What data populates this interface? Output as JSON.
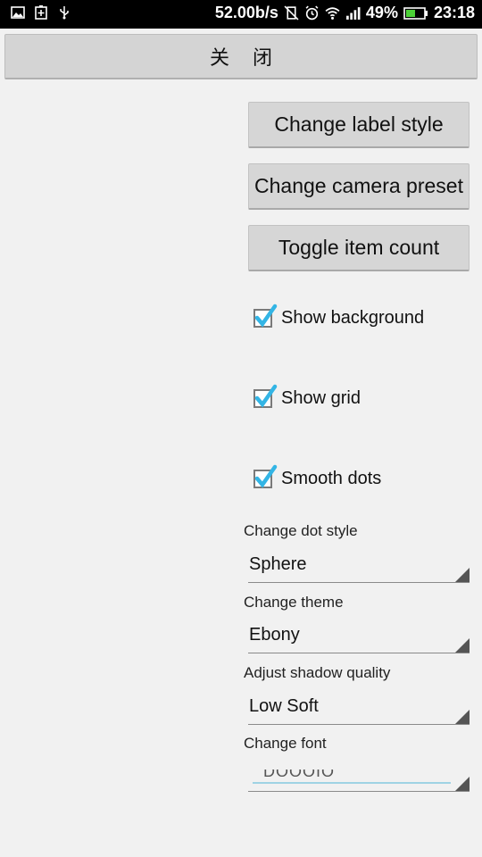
{
  "status_bar": {
    "left_icons": [
      "image-icon",
      "battery-saver-icon",
      "usb-icon"
    ],
    "network_speed": "52.00b/s",
    "signal": "ıııl",
    "battery": "49%",
    "time": "23:18"
  },
  "close_bar": {
    "label": "关闭"
  },
  "buttons": {
    "label_style": "Change label style",
    "camera_preset": "Change camera preset",
    "item_count": "Toggle item count"
  },
  "checkboxes": [
    {
      "label": "Show background",
      "checked": true
    },
    {
      "label": "Show grid",
      "checked": true
    },
    {
      "label": "Smooth dots",
      "checked": true
    }
  ],
  "spinners": [
    {
      "label": "Change dot style",
      "value": "Sphere"
    },
    {
      "label": "Change theme",
      "value": "Ebony"
    },
    {
      "label": "Adjust shadow quality",
      "value": "Low Soft"
    },
    {
      "label": "Change font",
      "value": "DOOOIO"
    }
  ],
  "colors": {
    "check_accent": "#33b5e5",
    "battery_fill": "#4cd137"
  }
}
